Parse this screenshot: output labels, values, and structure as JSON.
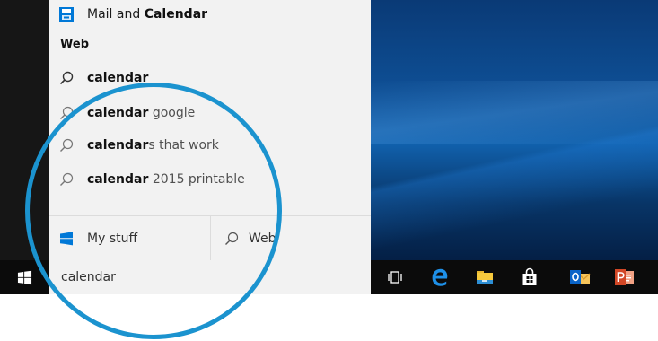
{
  "results": {
    "top_app": {
      "prefix": "Mail and ",
      "match": "Calendar"
    },
    "section_label": "Web",
    "web_suggestions": [
      {
        "match": "calendar",
        "rest": ""
      },
      {
        "match": "calendar",
        "rest": " google"
      },
      {
        "match": "calendar",
        "rest": "s that work"
      },
      {
        "match": "calendar",
        "rest": " 2015 printable"
      }
    ]
  },
  "scope": {
    "my_stuff_label": "My stuff",
    "web_label": "Web"
  },
  "search": {
    "query": "calendar"
  },
  "taskbar": {
    "icons": [
      "task-view-icon",
      "edge-icon",
      "file-explorer-icon",
      "store-icon",
      "outlook-icon",
      "powerpoint-icon"
    ]
  },
  "colors": {
    "annotation_circle": "#1b93cf",
    "accent_blue": "#0078d7",
    "desktop_blue": "#0e4f95"
  }
}
